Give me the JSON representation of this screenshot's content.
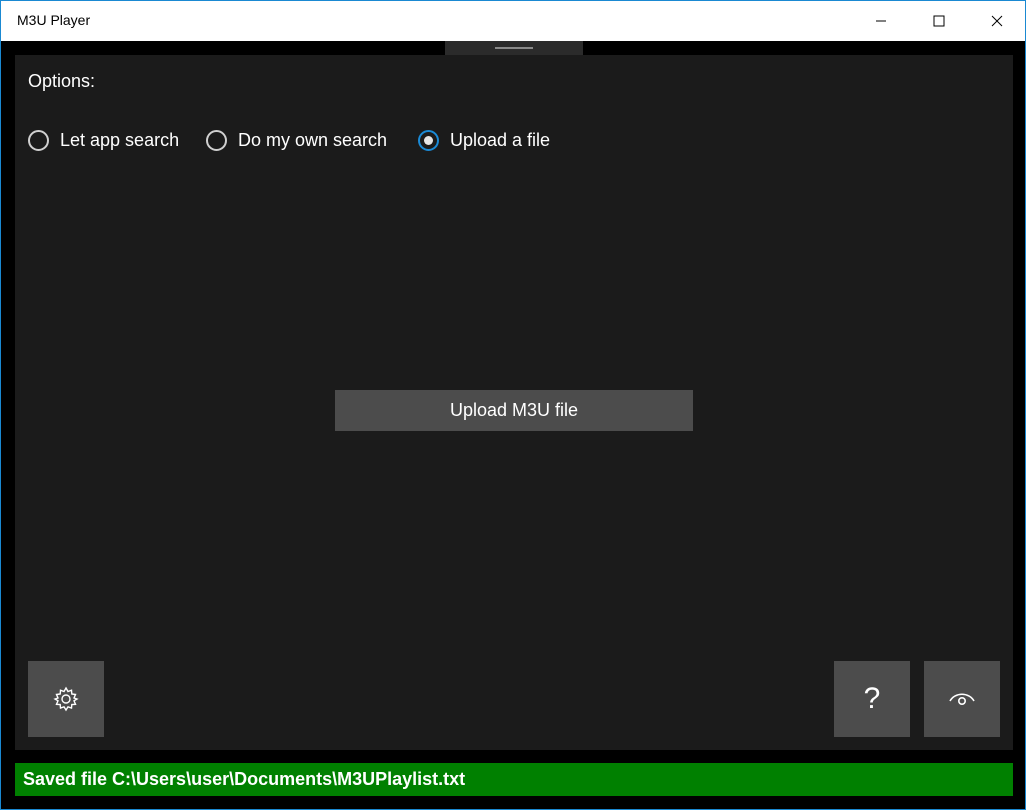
{
  "window": {
    "title": "M3U Player",
    "controls": {
      "minimize": "minimize-icon",
      "maximize": "maximize-icon",
      "close": "close-icon"
    }
  },
  "options": {
    "label": "Options:",
    "radios": [
      {
        "label": "Let app search",
        "checked": false
      },
      {
        "label": "Do my own search",
        "checked": false
      },
      {
        "label": "Upload a file",
        "checked": true
      }
    ]
  },
  "upload_button": {
    "label": "Upload M3U file"
  },
  "toolbar": {
    "settings_icon": "gear-icon",
    "help_label": "?",
    "eye_icon": "eye-icon"
  },
  "status": {
    "text": "Saved file C:\\Users\\user\\Documents\\M3UPlaylist.txt",
    "color": "#008000"
  },
  "colors": {
    "accent": "#1a8ad6",
    "panel": "#1b1b1b",
    "button": "#4c4c4c"
  }
}
